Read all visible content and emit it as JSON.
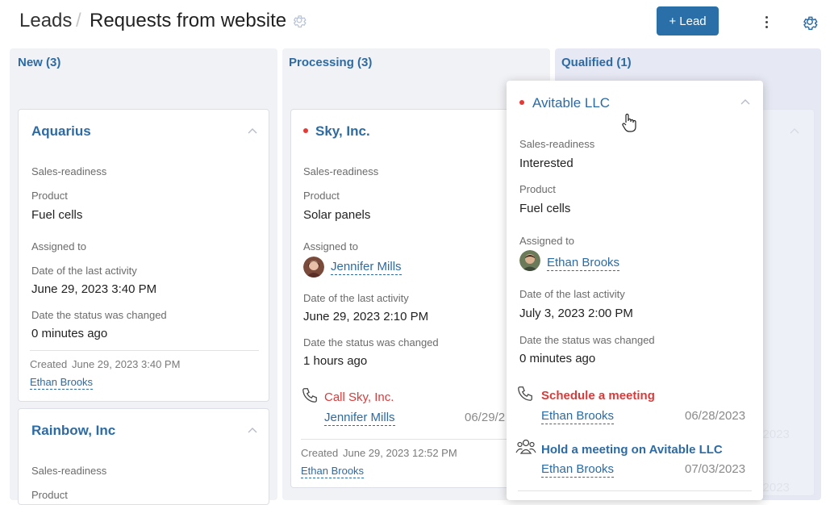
{
  "header": {
    "breadcrumb_root": "Leads",
    "separator": "/",
    "title": "Requests from website",
    "add_button": "+ Lead"
  },
  "columns": [
    {
      "title": "New (3)"
    },
    {
      "title": "Processing (3)"
    },
    {
      "title": "Qualified (1)"
    }
  ],
  "new_cards": [
    {
      "title": "Aquarius",
      "sales_label": "Sales-readiness",
      "product_label": "Product",
      "product": "Fuel cells",
      "assigned_label": "Assigned to",
      "last_activity_label": "Date of the last activity",
      "last_activity": "June 29, 2023 3:40 PM",
      "status_changed_label": "Date the status was changed",
      "status_changed": "0 minutes ago",
      "created_label": "Created",
      "created_date": "June 29, 2023 3:40 PM",
      "created_by": "Ethan Brooks"
    },
    {
      "title": "Rainbow, Inc",
      "sales_label": "Sales-readiness",
      "product_label": "Product"
    }
  ],
  "processing_card": {
    "title": "Sky, Inc.",
    "sales_label": "Sales-readiness",
    "product_label": "Product",
    "product": "Solar panels",
    "assigned_label": "Assigned to",
    "assignee": "Jennifer Mills",
    "last_activity_label": "Date of the last activity",
    "last_activity": "June 29, 2023 2:10 PM",
    "status_changed_label": "Date the status was changed",
    "status_changed": "1 hours ago",
    "task_title": "Call Sky, Inc.",
    "task_assignee": "Jennifer Mills",
    "task_date": "06/29/2",
    "created_label": "Created",
    "created_date": "June 29, 2023 12:52 PM",
    "created_by": "Ethan Brooks"
  },
  "popup": {
    "title": "Avitable LLC",
    "sales_label": "Sales-readiness",
    "sales_value": "Interested",
    "product_label": "Product",
    "product": "Fuel cells",
    "assigned_label": "Assigned to",
    "assignee": "Ethan Brooks",
    "last_activity_label": "Date of the last activity",
    "last_activity": "July 3, 2023 2:00 PM",
    "status_changed_label": "Date the status was changed",
    "status_changed": "0 minutes ago",
    "tasks": [
      {
        "title": "Schedule a meeting",
        "assignee": "Ethan Brooks",
        "date": "06/28/2023"
      },
      {
        "title": "Hold a meeting on Avitable LLC",
        "assignee": "Ethan Brooks",
        "date": "07/03/2023"
      }
    ]
  },
  "ghost_dates": [
    "8/2023",
    "8/2023"
  ],
  "colors": {
    "accent": "#2a6fa8",
    "link": "#2c6ba4",
    "danger": "#d93b3b",
    "column_bg": "#f1f2f5",
    "qualified_bg": "#e6e8f3"
  },
  "icons": [
    "gear-icon",
    "kebab-icon",
    "chevron-up-icon",
    "phone-icon",
    "people-icon",
    "cursor-hand-icon"
  ]
}
